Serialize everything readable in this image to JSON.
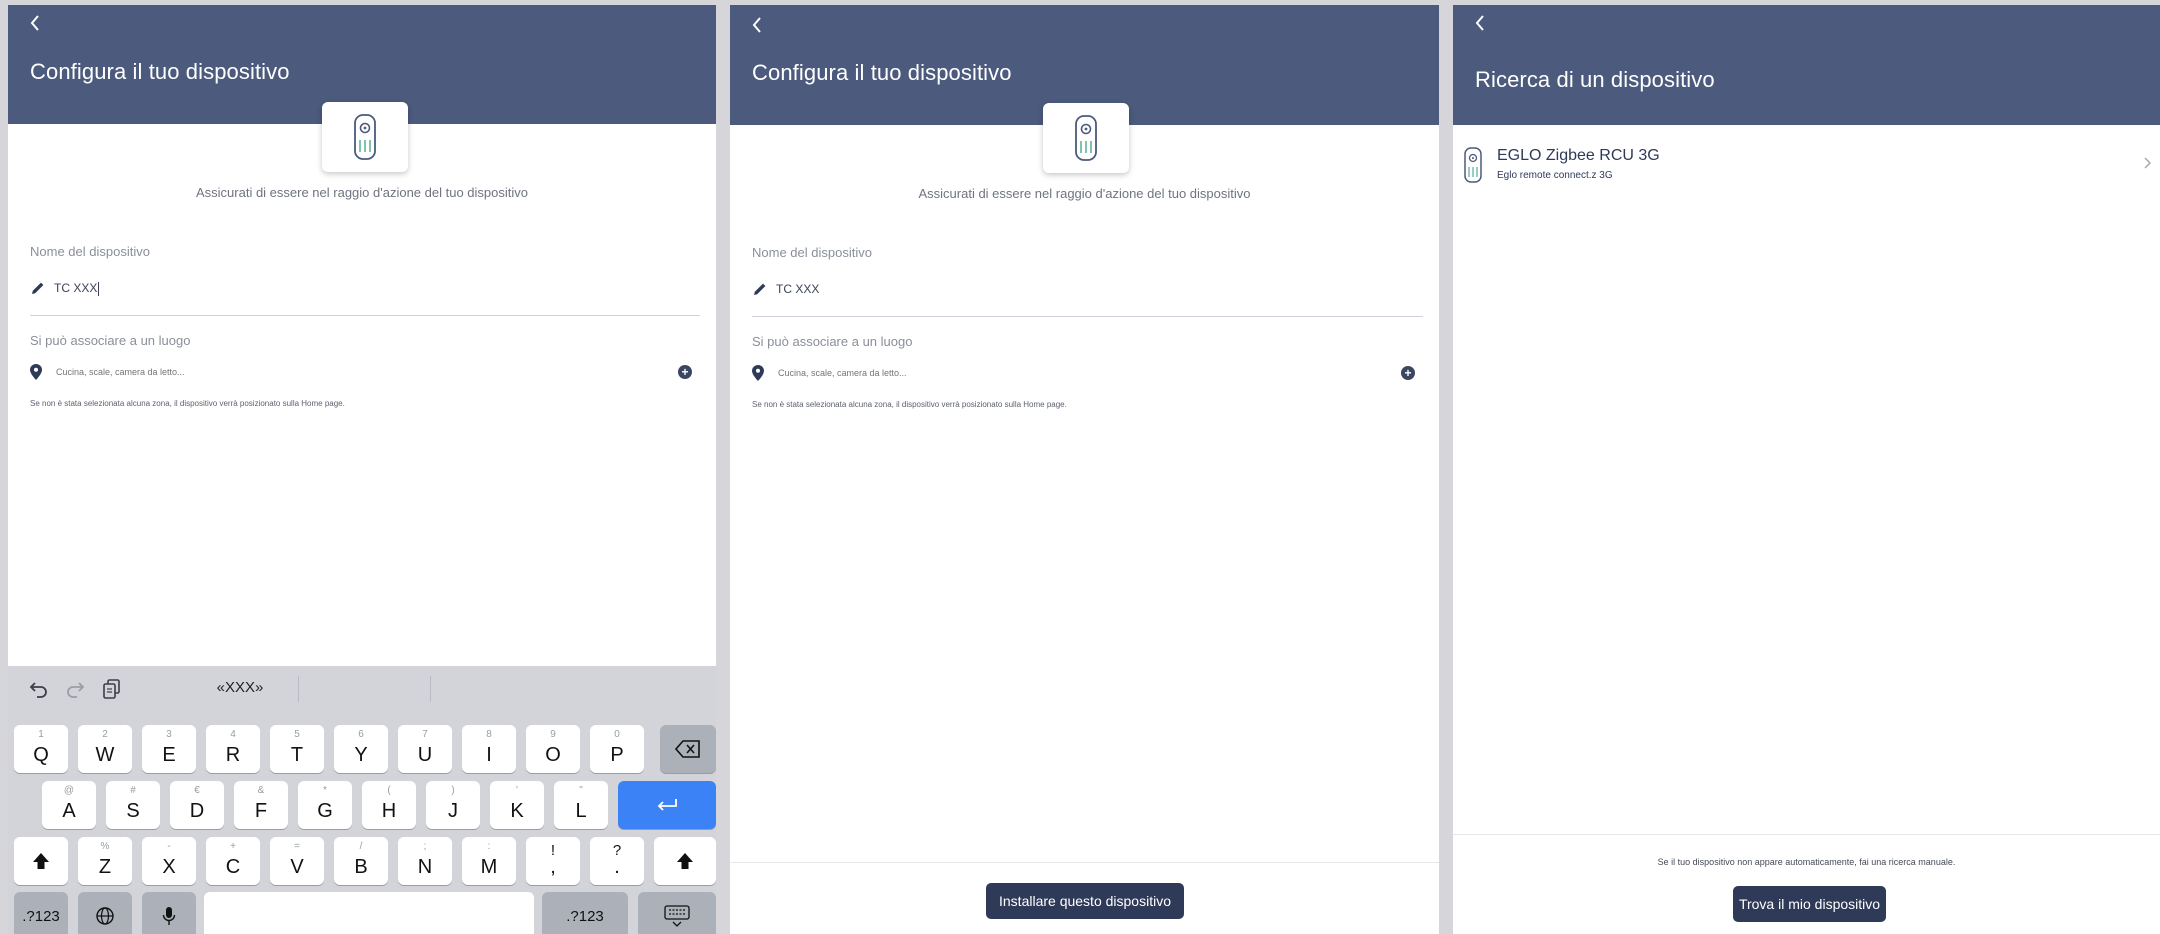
{
  "panel1": {
    "title": "Configura il tuo dispositivo",
    "hint": "Assicurati di essere nel raggio d'azione del tuo dispositivo",
    "name_label": "Nome del dispositivo",
    "name_value": "TC XXX",
    "location_label": "Si può associare a un luogo",
    "location_placeholder": "Cucina, scale, camera da letto...",
    "location_note": "Se non è stata selezionata alcuna zona, il dispositivo verrà posizionato sulla Home page."
  },
  "keyboard": {
    "suggestion": "«XXX»",
    "row1": [
      [
        "1",
        "Q"
      ],
      [
        "2",
        "W"
      ],
      [
        "3",
        "E"
      ],
      [
        "4",
        "R"
      ],
      [
        "5",
        "T"
      ],
      [
        "6",
        "Y"
      ],
      [
        "7",
        "U"
      ],
      [
        "8",
        "I"
      ],
      [
        "9",
        "O"
      ],
      [
        "0",
        "P"
      ]
    ],
    "row2": [
      [
        "@",
        "A"
      ],
      [
        "#",
        "S"
      ],
      [
        "€",
        "D"
      ],
      [
        "&",
        "F"
      ],
      [
        "*",
        "G"
      ],
      [
        "(",
        "H"
      ],
      [
        ")",
        "J"
      ],
      [
        "'",
        "K"
      ],
      [
        "\"",
        "L"
      ]
    ],
    "row3": [
      [
        "%",
        "Z"
      ],
      [
        "-",
        "X"
      ],
      [
        "+",
        "C"
      ],
      [
        "=",
        "V"
      ],
      [
        "/",
        "B"
      ],
      [
        ";",
        "N"
      ],
      [
        ":",
        "M"
      ],
      [
        "!",
        ","
      ],
      [
        "?",
        "."
      ]
    ],
    "numbers_label": ".?123"
  },
  "panel2": {
    "title": "Configura il tuo dispositivo",
    "hint": "Assicurati di essere nel raggio d'azione del tuo dispositivo",
    "name_label": "Nome del dispositivo",
    "name_value": "TC XXX",
    "location_label": "Si può associare a un luogo",
    "location_placeholder": "Cucina, scale, camera da letto...",
    "location_note": "Se non è stata selezionata alcuna zona, il dispositivo verrà posizionato sulla Home page.",
    "install_button": "Installare questo dispositivo"
  },
  "panel3": {
    "title": "Ricerca di un dispositivo",
    "device_name": "EGLO Zigbee RCU 3G",
    "device_sub": "Eglo remote connect.z 3G",
    "footer_hint": "Se il tuo dispositivo non appare automaticamente, fai una ricerca manuale.",
    "find_button": "Trova il mio dispositivo"
  },
  "colors": {
    "header": "#4b5a7d",
    "button": "#2f3a58",
    "return_key": "#3b82f6",
    "remote_green": "#5fb59b"
  },
  "icons": [
    "back-chevron-icon",
    "remote-icon",
    "pencil-icon",
    "location-pin-icon",
    "plus-circle-icon",
    "undo-icon",
    "redo-icon",
    "paste-icon",
    "backspace-icon",
    "return-icon",
    "shift-icon",
    "globe-icon",
    "microphone-icon",
    "keyboard-hide-icon",
    "chevron-right-icon"
  ]
}
